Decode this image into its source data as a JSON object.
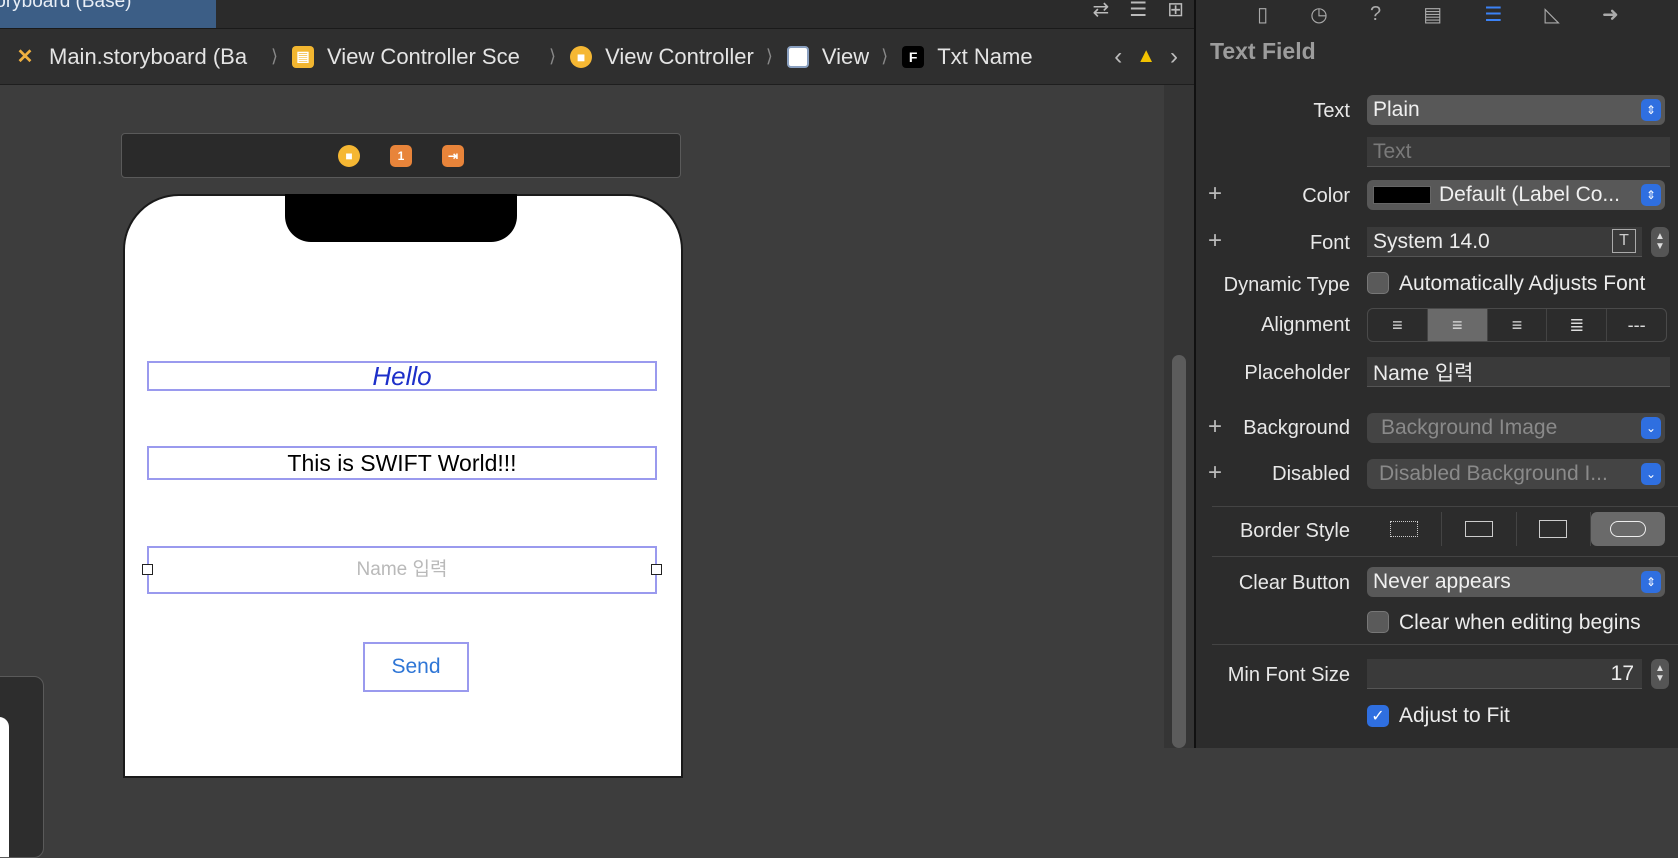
{
  "window": {
    "file_tab": "toryboard (Base)"
  },
  "breadcrumb": {
    "items": [
      {
        "icon": "storyboard-icon",
        "label": "Main.storyboard (Ba"
      },
      {
        "icon": "scene-icon",
        "label": "View Controller Sce"
      },
      {
        "icon": "view-controller-icon",
        "label": "View Controller"
      },
      {
        "icon": "view-icon",
        "label": "View"
      },
      {
        "icon": "text-field-icon",
        "icon_text": "F",
        "label": "Txt Name"
      }
    ]
  },
  "scene": {
    "dock_exit_number": "1",
    "hello_label": "Hello",
    "world_label": "This is SWIFT World!!!",
    "name_placeholder": "Name 입력",
    "send_button": "Send"
  },
  "inspector": {
    "title": "Text Field",
    "text": {
      "label": "Text",
      "value": "Plain",
      "placeholder": "Text"
    },
    "color": {
      "label": "Color",
      "value": "Default (Label Co...",
      "swatch": "#000000"
    },
    "font": {
      "label": "Font",
      "value": "System 14.0"
    },
    "dynamic_type": {
      "label": "Dynamic Type",
      "checkbox": "Automatically Adjusts Font",
      "checked": false
    },
    "alignment": {
      "label": "Alignment",
      "selected": "center"
    },
    "placeholder": {
      "label": "Placeholder",
      "value": "Name 입력"
    },
    "background": {
      "label": "Background",
      "value": "Background Image"
    },
    "disabled": {
      "label": "Disabled",
      "value": "Disabled Background I..."
    },
    "border_style": {
      "label": "Border Style",
      "selected": "rounded"
    },
    "clear_button": {
      "label": "Clear Button",
      "value": "Never appears",
      "checkbox": "Clear when editing begins",
      "checked": false
    },
    "min_font_size": {
      "label": "Min Font Size",
      "value": "17"
    },
    "adjust_to_fit": {
      "label": "Adjust to Fit",
      "checked": true
    }
  },
  "colors": {
    "accent": "#2f6fe0",
    "selection_outline": "#9a9aee",
    "hello_text": "#1d2fc9",
    "button_text": "#2f76d6",
    "warning": "#f2c200"
  }
}
